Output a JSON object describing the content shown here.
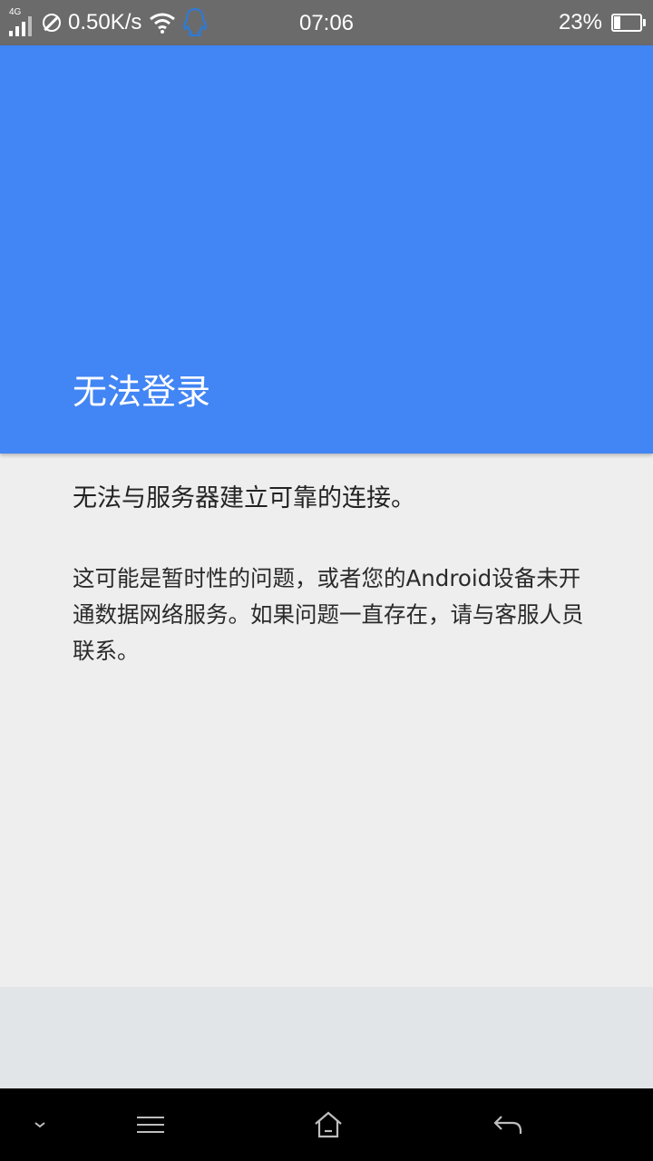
{
  "status_bar": {
    "network_type": "4G",
    "net_speed": "0.50K/s",
    "time": "07:06",
    "battery_percent": "23%",
    "battery_level": 0.23,
    "icons": [
      "signal-icon",
      "do-not-disturb-icon",
      "wifi-icon",
      "qq-icon",
      "battery-icon"
    ]
  },
  "header": {
    "title": "无法登录",
    "color": "#4285f4"
  },
  "message": {
    "headline": "无法与服务器建立可靠的连接。",
    "body": "这可能是暂时性的问题，或者您的Android设备未开通数据网络服务。如果问题一直存在，请与客服人员联系。"
  },
  "nav_bar": {
    "buttons": [
      "collapse-icon",
      "menu-icon",
      "home-icon",
      "back-icon"
    ]
  }
}
